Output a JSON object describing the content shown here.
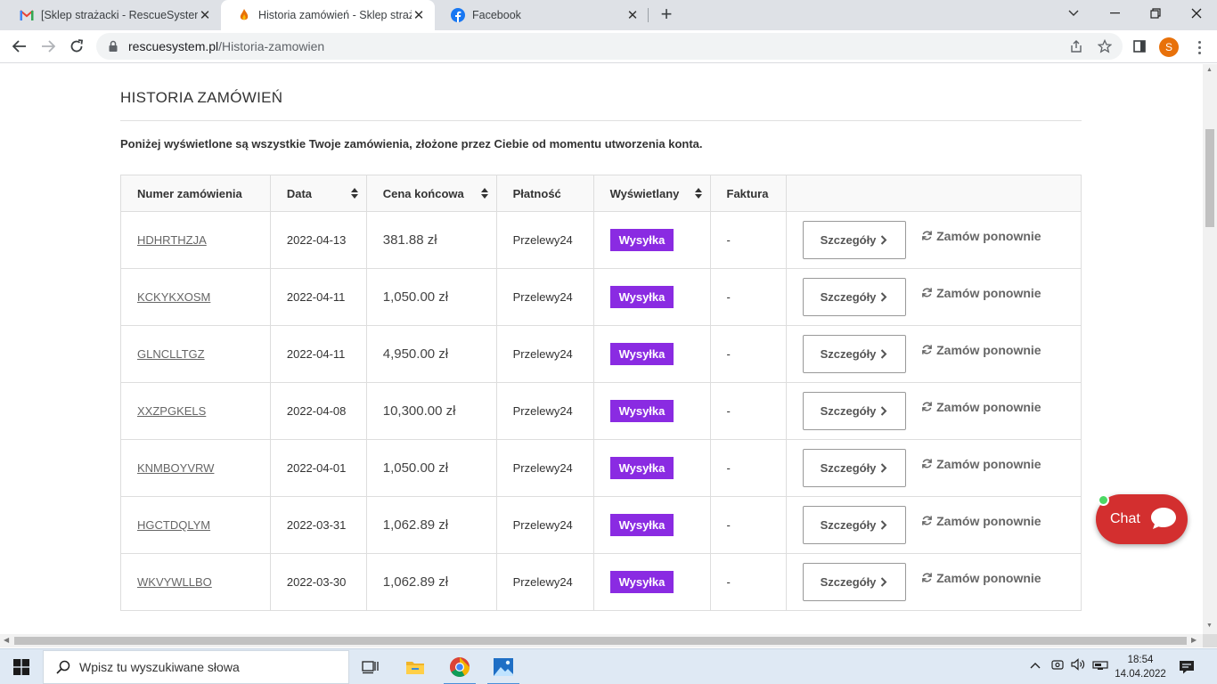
{
  "browser": {
    "tabs": [
      {
        "title": "[Sklep strażacki - RescueSystem]",
        "favicon": "gmail-icon",
        "active": false
      },
      {
        "title": "Historia zamówień - Sklep straża",
        "favicon": "flame-icon",
        "active": true
      },
      {
        "title": "Facebook",
        "favicon": "facebook-icon",
        "active": false
      }
    ],
    "url_host": "rescuesystem.pl",
    "url_path": "/Historia-zamowien",
    "profile_initial": "S"
  },
  "page": {
    "title": "HISTORIA ZAMÓWIEŃ",
    "intro": "Poniżej wyświetlone są wszystkie Twoje zamówienia, złożone przez Ciebie od momentu utworzenia konta.",
    "columns": [
      "Numer zamówienia",
      "Data",
      "Cena końcowa",
      "Płatność",
      "Wyświetlany",
      "Faktura",
      ""
    ],
    "details_label": "Szczegóły",
    "reorder_label": "Zamów ponownie",
    "status_color": "#8a2be2",
    "orders": [
      {
        "number": "HDHRTHZJA",
        "date": "2022-04-13",
        "price": "381.88 zł",
        "payment": "Przelewy24",
        "status": "Wysyłka",
        "invoice": "-"
      },
      {
        "number": "KCKYKXOSM",
        "date": "2022-04-11",
        "price": "1,050.00 zł",
        "payment": "Przelewy24",
        "status": "Wysyłka",
        "invoice": "-"
      },
      {
        "number": "GLNCLLTGZ",
        "date": "2022-04-11",
        "price": "4,950.00 zł",
        "payment": "Przelewy24",
        "status": "Wysyłka",
        "invoice": "-"
      },
      {
        "number": "XXZPGKELS",
        "date": "2022-04-08",
        "price": "10,300.00 zł",
        "payment": "Przelewy24",
        "status": "Wysyłka",
        "invoice": "-"
      },
      {
        "number": "KNMBOYVRW",
        "date": "2022-04-01",
        "price": "1,050.00 zł",
        "payment": "Przelewy24",
        "status": "Wysyłka",
        "invoice": "-"
      },
      {
        "number": "HGCTDQLYM",
        "date": "2022-03-31",
        "price": "1,062.89 zł",
        "payment": "Przelewy24",
        "status": "Wysyłka",
        "invoice": "-"
      },
      {
        "number": "WKVYWLLBO",
        "date": "2022-03-30",
        "price": "1,062.89 zł",
        "payment": "Przelewy24",
        "status": "Wysyłka",
        "invoice": "-"
      }
    ],
    "chat_label": "Chat",
    "chat_color": "#d32f2f"
  },
  "taskbar": {
    "search_placeholder": "Wpisz tu wyszukiwane słowa",
    "time": "18:54",
    "date": "14.04.2022"
  }
}
